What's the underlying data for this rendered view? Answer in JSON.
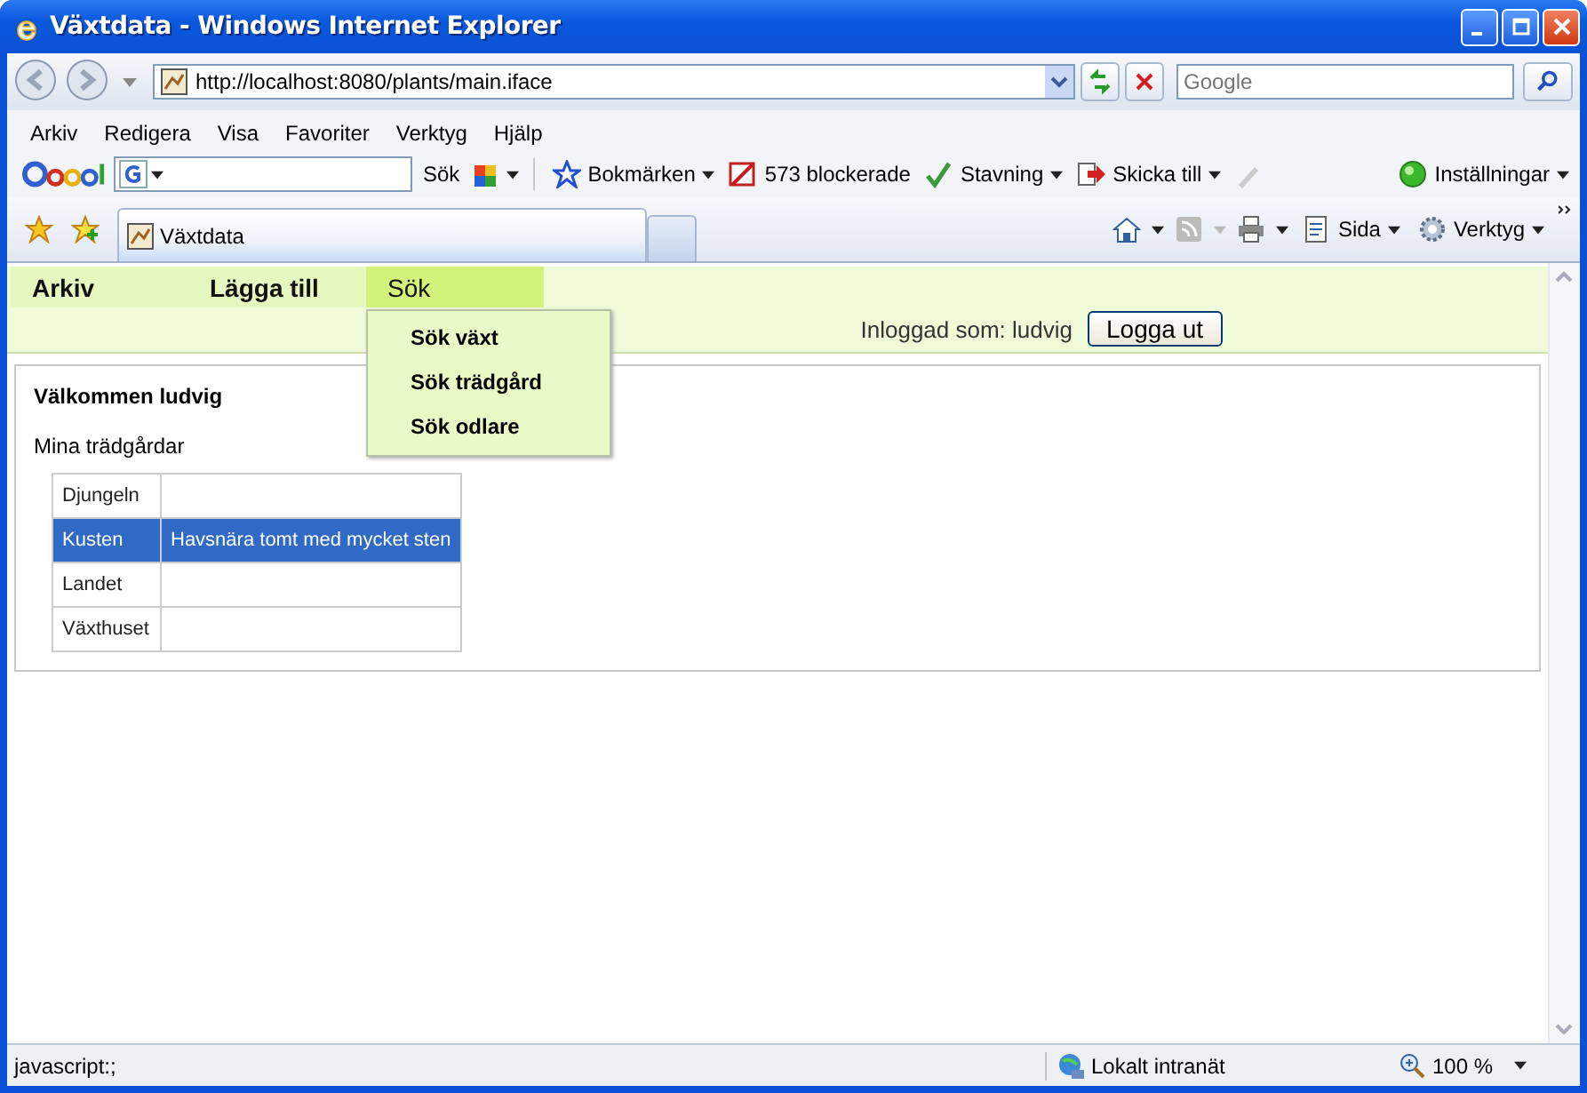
{
  "window": {
    "title": "Växtdata - Windows Internet Explorer"
  },
  "address_bar": {
    "url": "http://localhost:8080/plants/main.iface"
  },
  "search_field": {
    "placeholder": "Google"
  },
  "menu_bar": [
    "Arkiv",
    "Redigera",
    "Visa",
    "Favoriter",
    "Verktyg",
    "Hjälp"
  ],
  "google_toolbar": {
    "search_button": "Sök",
    "items": [
      {
        "kind": "bookmarks",
        "label": "Bokmärken",
        "dropdown": true
      },
      {
        "kind": "popups",
        "label": "573 blockerade",
        "dropdown": false
      },
      {
        "kind": "spelling",
        "label": "Stavning",
        "dropdown": true
      },
      {
        "kind": "send",
        "label": "Skicka till",
        "dropdown": true
      }
    ],
    "settings": "Inställningar"
  },
  "tabs": [
    {
      "label": "Växtdata",
      "selected": true
    }
  ],
  "command_bar": [
    {
      "kind": "page",
      "label": "Sida"
    },
    {
      "kind": "tools",
      "label": "Verktyg"
    }
  ],
  "app_menu": [
    {
      "label": "Arkiv",
      "selected": false
    },
    {
      "label": "Lägga till",
      "selected": false
    },
    {
      "label": "Sök",
      "selected": true,
      "submenu": [
        "Sök växt",
        "Sök trädgård",
        "Sök odlare"
      ]
    }
  ],
  "login": {
    "text": "Inloggad som: ludvig",
    "button": "Logga ut"
  },
  "welcome": "Välkommen ludvig",
  "gardens": {
    "title": "Mina trädgårdar",
    "rows": [
      {
        "name": "Djungeln",
        "selected": false
      },
      {
        "name": "Kusten",
        "description": "Havsnära tomt med mycket sten",
        "selected": true
      },
      {
        "name": "Landet",
        "selected": false
      },
      {
        "name": "Växthuset",
        "selected": false
      }
    ]
  },
  "status_bar": {
    "text": "javascript:;",
    "zone": "Lokalt intranät",
    "zoom": "100 %"
  }
}
